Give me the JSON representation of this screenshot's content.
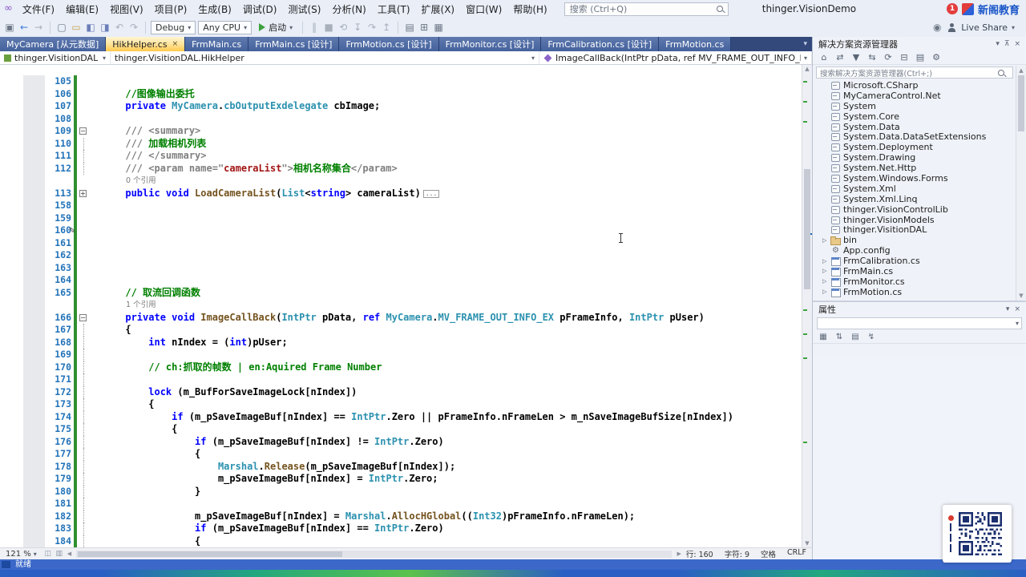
{
  "window": {
    "title": "thinger.VisionDemo"
  },
  "menubar": {
    "menus": [
      "文件(F)",
      "编辑(E)",
      "视图(V)",
      "项目(P)",
      "生成(B)",
      "调试(D)",
      "测试(S)",
      "分析(N)",
      "工具(T)",
      "扩展(X)",
      "窗口(W)",
      "帮助(H)"
    ],
    "search_placeholder": "搜索 (Ctrl+Q)",
    "badge": "1",
    "brand": "新阁教育"
  },
  "toolbar": {
    "debug": "Debug",
    "platform": "Any CPU",
    "start": "启动",
    "live_share": "Live Share",
    "group1": [
      {
        "name": "window-layout-icon",
        "glyph": "▣",
        "color": "#6E7886"
      },
      {
        "name": "navigate-back-icon",
        "glyph": "←",
        "color": "#3E7BD8"
      },
      {
        "name": "navigate-forward-icon",
        "glyph": "→",
        "color": "#A8B0BB"
      }
    ],
    "group2": [
      {
        "name": "new-file-icon",
        "glyph": "▢",
        "color": "#6E7886"
      },
      {
        "name": "open-file-icon",
        "glyph": "▭",
        "color": "#C9A44C"
      },
      {
        "name": "save-icon",
        "glyph": "◧",
        "color": "#6B7DB8"
      },
      {
        "name": "save-all-icon",
        "glyph": "◨",
        "color": "#6B7DB8"
      },
      {
        "name": "undo-icon",
        "glyph": "↶",
        "color": "#A8B0BB"
      },
      {
        "name": "redo-icon",
        "glyph": "↷",
        "color": "#A8B0BB"
      }
    ],
    "debug_controls": [
      {
        "name": "pause-icon",
        "glyph": "‖",
        "color": "#A8B0BB"
      },
      {
        "name": "stop-icon",
        "glyph": "■",
        "color": "#A8B0BB"
      },
      {
        "name": "restart-icon",
        "glyph": "⟲",
        "color": "#A8B0BB"
      },
      {
        "name": "step-into-icon",
        "glyph": "↧",
        "color": "#A8B0BB"
      },
      {
        "name": "step-over-icon",
        "glyph": "↷",
        "color": "#A8B0BB"
      },
      {
        "name": "step-out-icon",
        "glyph": "↥",
        "color": "#A8B0BB"
      }
    ],
    "group4": [
      {
        "name": "solution-explorer-icon",
        "glyph": "▤",
        "color": "#6E7886"
      },
      {
        "name": "toolbox-icon",
        "glyph": "⊞",
        "color": "#6E7886"
      },
      {
        "name": "extensions-icon",
        "glyph": "▦",
        "color": "#6E7886"
      }
    ],
    "right_icons": [
      {
        "name": "feedback-icon",
        "glyph": "◉",
        "color": "#6E7886"
      }
    ]
  },
  "tabs": [
    {
      "label": "MyCamera [从元数据]",
      "active": false
    },
    {
      "label": "HikHelper.cs",
      "active": true
    },
    {
      "label": "FrmMain.cs",
      "active": false
    },
    {
      "label": "FrmMain.cs [设计]",
      "active": false
    },
    {
      "label": "FrmMotion.cs [设计]",
      "active": false
    },
    {
      "label": "FrmMonitor.cs [设计]",
      "active": false
    },
    {
      "label": "FrmCalibration.cs [设计]",
      "active": false
    },
    {
      "label": "FrmMotion.cs",
      "active": false
    }
  ],
  "navbar": {
    "project": "thinger.VisitionDAL",
    "type": "thinger.VisitionDAL.HikHelper",
    "member": "ImageCallBack(IntPtr pData, ref MV_FRAME_OUT_INFO_EX pFrameInfo, IntPtr ..."
  },
  "editor": {
    "zoom": "121 %",
    "line_info": [
      "行: 160",
      "字符: 9",
      "空格",
      "CRLF"
    ],
    "status_icons": [
      {
        "name": "split-window-icon",
        "glyph": "◫",
        "color": "#8A93A2"
      },
      {
        "name": "word-wrap-icon",
        "glyph": "▥",
        "color": "#8A93A2"
      }
    ],
    "rows": [
      {
        "n": "105"
      },
      {
        "n": "106",
        "seg": [
          [
            "c",
            "      //图像输出委托"
          ]
        ]
      },
      {
        "n": "107",
        "seg": [
          [
            "k",
            "      private "
          ],
          [
            "t",
            "MyCamera"
          ],
          [
            "p",
            "."
          ],
          [
            "t",
            "cbOutputExdelegate"
          ],
          [
            "p",
            " cbImage;"
          ]
        ]
      },
      {
        "n": "108"
      },
      {
        "n": "109",
        "fold": "-",
        "seg": [
          [
            "d",
            "      /// <summary>"
          ]
        ]
      },
      {
        "n": "110",
        "fline": 1,
        "seg": [
          [
            "d",
            "      /// "
          ],
          [
            "c",
            "加载相机列表"
          ]
        ]
      },
      {
        "n": "111",
        "fline": 1,
        "seg": [
          [
            "d",
            "      /// </summary>"
          ]
        ]
      },
      {
        "n": "112",
        "fline": 1,
        "seg": [
          [
            "d",
            "      /// <param name=\""
          ],
          [
            "s",
            "cameraList"
          ],
          [
            "d",
            "\">"
          ],
          [
            "c",
            "相机名称集合"
          ],
          [
            "d",
            "</param>"
          ]
        ]
      },
      {
        "lens": "0 个引用"
      },
      {
        "n": "113",
        "fold": "+",
        "box": "...",
        "seg": [
          [
            "k",
            "      public void "
          ],
          [
            "m",
            "LoadCameraList"
          ],
          [
            "p",
            "("
          ],
          [
            "t",
            "List"
          ],
          [
            "p",
            "<"
          ],
          [
            "k",
            "string"
          ],
          [
            "p",
            "> cameraList)"
          ]
        ]
      },
      {
        "n": "158"
      },
      {
        "n": "159"
      },
      {
        "n": "160",
        "pen": 1
      },
      {
        "n": "161"
      },
      {
        "n": "162"
      },
      {
        "n": "163"
      },
      {
        "n": "164"
      },
      {
        "n": "165",
        "seg": [
          [
            "c",
            "      // 取流回调函数"
          ]
        ]
      },
      {
        "lens": "1 个引用"
      },
      {
        "n": "166",
        "fold": "-",
        "seg": [
          [
            "k",
            "      private void "
          ],
          [
            "m",
            "ImageCallBack"
          ],
          [
            "p",
            "("
          ],
          [
            "t",
            "IntPtr"
          ],
          [
            "p",
            " pData, "
          ],
          [
            "k",
            "ref "
          ],
          [
            "t",
            "MyCamera"
          ],
          [
            "p",
            "."
          ],
          [
            "t",
            "MV_FRAME_OUT_INFO_EX"
          ],
          [
            "p",
            " pFrameInfo, "
          ],
          [
            "t",
            "IntPtr"
          ],
          [
            "p",
            " pUser)"
          ]
        ]
      },
      {
        "n": "167",
        "fline": 1,
        "seg": [
          [
            "p",
            "      {"
          ]
        ]
      },
      {
        "n": "168",
        "fline": 1,
        "seg": [
          [
            "p",
            "          "
          ],
          [
            "k",
            "int"
          ],
          [
            "p",
            " nIndex = ("
          ],
          [
            "k",
            "int"
          ],
          [
            "p",
            ")pUser;"
          ]
        ]
      },
      {
        "n": "169",
        "fline": 1
      },
      {
        "n": "170",
        "fline": 1,
        "seg": [
          [
            "c",
            "          // ch:抓取的帧数 | en:Aquired Frame Number"
          ]
        ]
      },
      {
        "n": "171",
        "fline": 1
      },
      {
        "n": "172",
        "fline": 1,
        "seg": [
          [
            "p",
            "          "
          ],
          [
            "k",
            "lock"
          ],
          [
            "p",
            " (m_BufForSaveImageLock[nIndex])"
          ]
        ]
      },
      {
        "n": "173",
        "fline": 1,
        "seg": [
          [
            "p",
            "          {"
          ]
        ]
      },
      {
        "n": "174",
        "fline": 1,
        "seg": [
          [
            "p",
            "              "
          ],
          [
            "k",
            "if"
          ],
          [
            "p",
            " (m_pSaveImageBuf[nIndex] == "
          ],
          [
            "t",
            "IntPtr"
          ],
          [
            "p",
            ".Zero || pFrameInfo.nFrameLen > m_nSaveImageBufSize[nIndex])"
          ]
        ]
      },
      {
        "n": "175",
        "fline": 1,
        "seg": [
          [
            "p",
            "              {"
          ]
        ]
      },
      {
        "n": "176",
        "fline": 1,
        "seg": [
          [
            "p",
            "                  "
          ],
          [
            "k",
            "if"
          ],
          [
            "p",
            " (m_pSaveImageBuf[nIndex] != "
          ],
          [
            "t",
            "IntPtr"
          ],
          [
            "p",
            ".Zero)"
          ]
        ]
      },
      {
        "n": "177",
        "fline": 1,
        "seg": [
          [
            "p",
            "                  {"
          ]
        ]
      },
      {
        "n": "178",
        "fline": 1,
        "seg": [
          [
            "p",
            "                      "
          ],
          [
            "t",
            "Marshal"
          ],
          [
            "p",
            "."
          ],
          [
            "m",
            "Release"
          ],
          [
            "p",
            "(m_pSaveImageBuf[nIndex]);"
          ]
        ]
      },
      {
        "n": "179",
        "fline": 1,
        "seg": [
          [
            "p",
            "                      m_pSaveImageBuf[nIndex] = "
          ],
          [
            "t",
            "IntPtr"
          ],
          [
            "p",
            ".Zero;"
          ]
        ]
      },
      {
        "n": "180",
        "fline": 1,
        "seg": [
          [
            "p",
            "                  }"
          ]
        ]
      },
      {
        "n": "181",
        "fline": 1
      },
      {
        "n": "182",
        "fline": 1,
        "seg": [
          [
            "p",
            "                  m_pSaveImageBuf[nIndex] = "
          ],
          [
            "t",
            "Marshal"
          ],
          [
            "p",
            "."
          ],
          [
            "m",
            "AllocHGlobal"
          ],
          [
            "p",
            "(("
          ],
          [
            "t",
            "Int32"
          ],
          [
            "p",
            ")pFrameInfo.nFrameLen);"
          ]
        ]
      },
      {
        "n": "183",
        "fline": 1,
        "seg": [
          [
            "p",
            "                  "
          ],
          [
            "k",
            "if"
          ],
          [
            "p",
            " (m_pSaveImageBuf[nIndex] == "
          ],
          [
            "t",
            "IntPtr"
          ],
          [
            "p",
            ".Zero)"
          ]
        ]
      },
      {
        "n": "184",
        "fline": 1,
        "seg": [
          [
            "p",
            "                  {"
          ]
        ]
      }
    ]
  },
  "solution_explorer": {
    "title": "解决方案资源管理器",
    "search_placeholder": "搜索解决方案资源管理器(Ctrl+;)",
    "toolbar_icons": [
      {
        "name": "home-icon",
        "glyph": "⌂"
      },
      {
        "name": "switch-views-icon",
        "glyph": "⇄"
      },
      {
        "name": "pending-changes-filter-icon",
        "glyph": "▼"
      },
      {
        "name": "sync-with-active-document-icon",
        "glyph": "⇆"
      },
      {
        "name": "refresh-icon",
        "glyph": "⟳"
      },
      {
        "name": "collapse-all-icon",
        "glyph": "⊟"
      },
      {
        "name": "show-all-files-icon",
        "glyph": "▤"
      },
      {
        "name": "properties-icon",
        "glyph": "⚙"
      }
    ],
    "items": [
      {
        "label": "Microsoft.CSharp",
        "icon": "ref"
      },
      {
        "label": "MyCameraControl.Net",
        "icon": "ref"
      },
      {
        "label": "System",
        "icon": "ref"
      },
      {
        "label": "System.Core",
        "icon": "ref"
      },
      {
        "label": "System.Data",
        "icon": "ref"
      },
      {
        "label": "System.Data.DataSetExtensions",
        "icon": "ref"
      },
      {
        "label": "System.Deployment",
        "icon": "ref"
      },
      {
        "label": "System.Drawing",
        "icon": "ref"
      },
      {
        "label": "System.Net.Http",
        "icon": "ref"
      },
      {
        "label": "System.Windows.Forms",
        "icon": "ref"
      },
      {
        "label": "System.Xml",
        "icon": "ref"
      },
      {
        "label": "System.Xml.Linq",
        "icon": "ref"
      },
      {
        "label": "thinger.VisionControlLib",
        "icon": "ref"
      },
      {
        "label": "thinger.VisionModels",
        "icon": "ref"
      },
      {
        "label": "thinger.VisitionDAL",
        "icon": "ref"
      },
      {
        "label": "bin",
        "icon": "folder",
        "exp": 1
      },
      {
        "label": "App.config",
        "icon": "gear"
      },
      {
        "label": "FrmCalibration.cs",
        "icon": "form",
        "exp": 1
      },
      {
        "label": "FrmMain.cs",
        "icon": "form",
        "exp": 1
      },
      {
        "label": "FrmMonitor.cs",
        "icon": "form",
        "exp": 1
      },
      {
        "label": "FrmMotion.cs",
        "icon": "form",
        "exp": 1
      }
    ]
  },
  "properties": {
    "title": "属性",
    "toolbar_icons": [
      {
        "name": "categorized-icon",
        "glyph": "▦"
      },
      {
        "name": "alphabetical-icon",
        "glyph": "⇅"
      },
      {
        "name": "properties-icon",
        "glyph": "▤"
      },
      {
        "name": "events-icon",
        "glyph": "↯"
      }
    ]
  },
  "statusbar": {
    "ready": "就绪"
  },
  "colors": {
    "active_tab": "#FFC84A",
    "tabbar_background": "#33497B",
    "statusbar_blue": "#3B68C9",
    "brand_blue": "#1A56C8",
    "badge_red": "#E33E3E",
    "line_number": "#2273B9",
    "change_bar_green": "#2F8F2F",
    "keyword": "#0000FF",
    "type": "#2B91AF",
    "comment": "#008000",
    "string": "#A31515",
    "method": "#74531F"
  }
}
